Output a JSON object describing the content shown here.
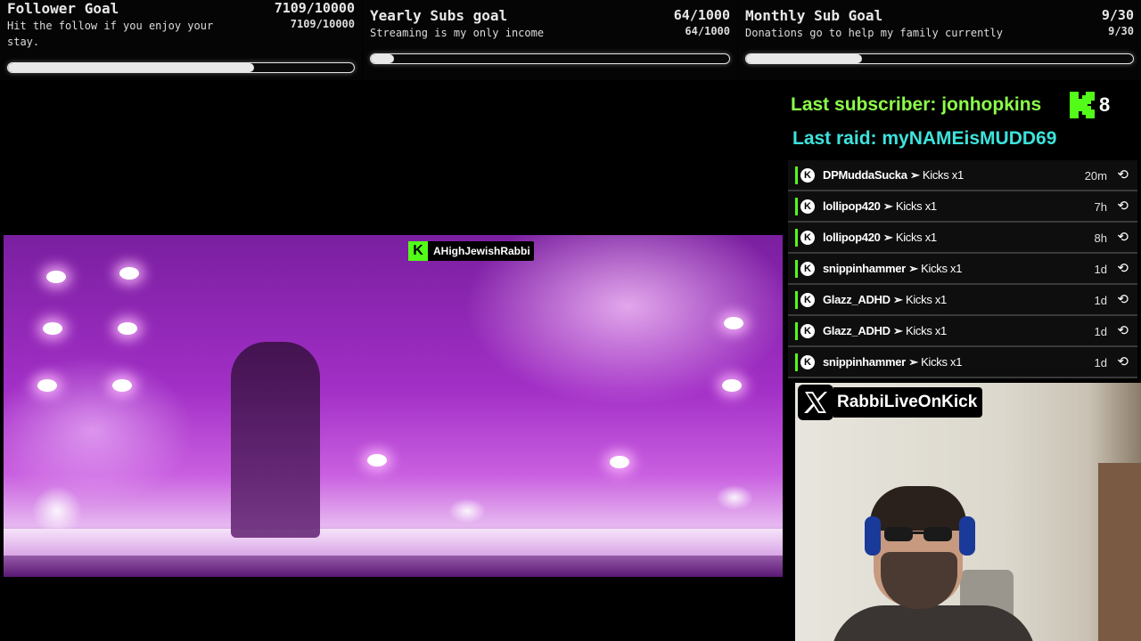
{
  "goals": [
    {
      "title": "Follower Goal",
      "count": "7109/10000",
      "desc": "Hit the follow if you enjoy your stay.",
      "count_small": "7109/10000",
      "progress": 0.711
    },
    {
      "title": "Yearly Subs goal",
      "count": "64/1000",
      "desc": "Streaming is my only income",
      "count_small": "64/1000",
      "progress": 0.064
    },
    {
      "title": "Monthly Sub Goal",
      "count": "9/30",
      "desc": "Donations go to help my family currently",
      "count_small": "9/30",
      "progress": 0.3
    }
  ],
  "alerts": {
    "last_subscriber": "Last subscriber: jonhopkins",
    "last_raid": "Last raid: myNAMEisMUDD69",
    "kick_count": "8"
  },
  "events": [
    {
      "user": "DPMuddaSucka",
      "action": "Kicks x1",
      "time": "20m"
    },
    {
      "user": "lollipop420",
      "action": "Kicks x1",
      "time": "7h"
    },
    {
      "user": "lollipop420",
      "action": "Kicks x1",
      "time": "8h"
    },
    {
      "user": "snippinhammer",
      "action": "Kicks x1",
      "time": "1d"
    },
    {
      "user": "Glazz_ADHD",
      "action": "Kicks x1",
      "time": "1d"
    },
    {
      "user": "Glazz_ADHD",
      "action": "Kicks x1",
      "time": "1d"
    },
    {
      "user": "snippinhammer",
      "action": "Kicks x1",
      "time": "1d"
    }
  ],
  "video": {
    "streamer_tag": "AHighJewishRabbi"
  },
  "webcam": {
    "x_handle": "RabbiLiveOnKick"
  },
  "colors": {
    "kick_green": "#53fc18",
    "sub_green": "#8cff4a",
    "raid_cyan": "#3de3dc"
  }
}
